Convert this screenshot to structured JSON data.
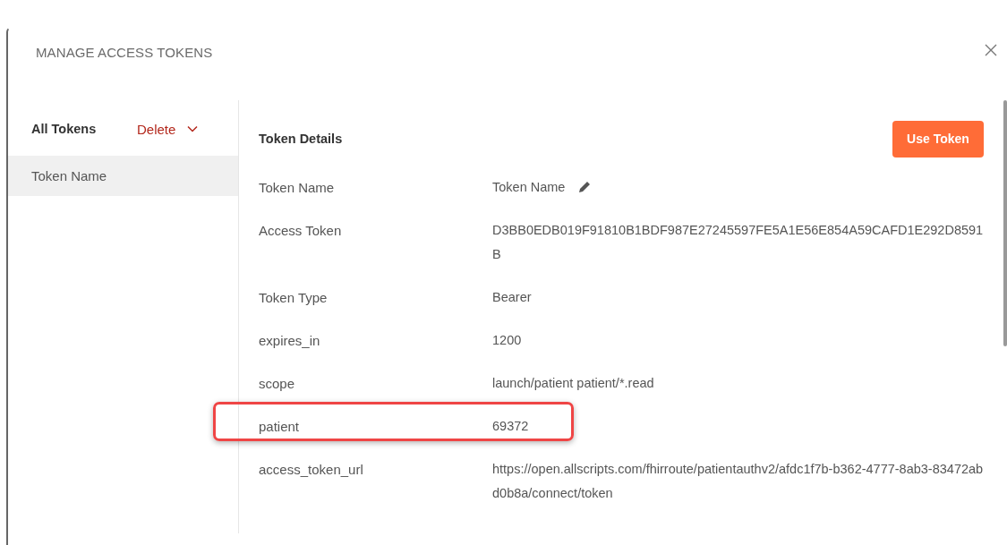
{
  "dialog": {
    "title": "MANAGE ACCESS TOKENS"
  },
  "sidebar": {
    "heading": "All Tokens",
    "delete_label": "Delete",
    "items": [
      {
        "label": "Token Name",
        "selected": true
      }
    ]
  },
  "details": {
    "heading": "Token Details",
    "use_button": "Use Token",
    "rows": [
      {
        "label": "Token Name",
        "value": "Token Name",
        "editable": true,
        "highlighted": false
      },
      {
        "label": "Access Token",
        "value": "D3BB0EDB019F91810B1BDF987E27245597FE5A1E56E854A59CAFD1E292D8591B",
        "editable": false,
        "highlighted": false
      },
      {
        "label": "Token Type",
        "value": "Bearer",
        "editable": false,
        "highlighted": false
      },
      {
        "label": "expires_in",
        "value": "1200",
        "editable": false,
        "highlighted": false
      },
      {
        "label": "scope",
        "value": "launch/patient patient/*.read",
        "editable": false,
        "highlighted": false
      },
      {
        "label": "patient",
        "value": "69372",
        "editable": false,
        "highlighted": true
      },
      {
        "label": "access_token_url",
        "value": "https://open.allscripts.com/fhirroute/patientauthv2/afdc1f7b-b362-4777-8ab3-83472abd0b8a/connect/token",
        "editable": false,
        "highlighted": false
      }
    ]
  }
}
